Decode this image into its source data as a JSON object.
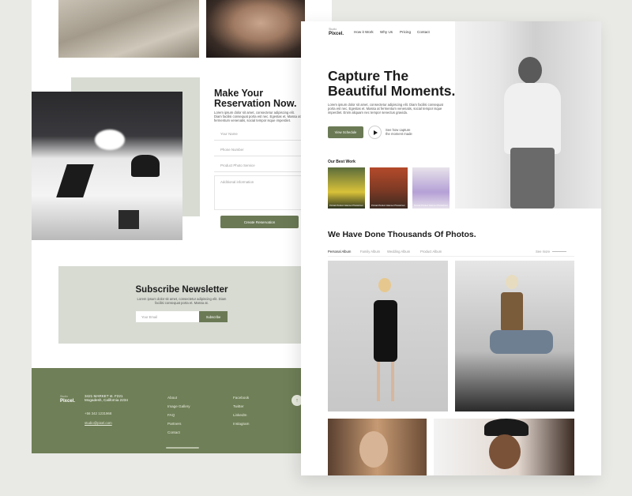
{
  "left": {
    "reservation": {
      "title_line1": "Make Your",
      "title_line2": "Reservation Now.",
      "desc": "Lorem ipsum dolor sit amet, consectetur adipiscing elit. Diam facilisi consequat porta est nec. Egestas et. Massa at fermentum venenatis, social tempor isque imperdiet.",
      "fields": [
        {
          "placeholder": "Your Name"
        },
        {
          "placeholder": "Phone Number"
        },
        {
          "placeholder": "Product Photo Service"
        }
      ],
      "textarea_placeholder": "Additional information",
      "button": "Create Reservation"
    },
    "newsletter": {
      "title": "Subscribe Newsletter",
      "desc": "Lorem ipsum dolor sit amet, consectetur adipiscing elit. Diam facilisi consequat porta et. Massa at.",
      "input_placeholder": "Your Email",
      "button": "Subscribe"
    },
    "footer": {
      "logo_small": "Studio",
      "logo": "Pixcel.",
      "address": "3421 MARKET st. F221 Mogadesh, California 2234",
      "phone": "+56 342 1231968",
      "email": "studio@pixel.com",
      "links_col1": [
        "About",
        "Image Gallery",
        "FAQ",
        "Partners",
        "Contact"
      ],
      "links_col2": [
        "Facebook",
        "Twitter",
        "LinkedIn",
        "Instagram"
      ],
      "scroll_icon": "arrow-up-icon"
    }
  },
  "right": {
    "nav": {
      "logo_small": "Studio",
      "logo": "Pixcel.",
      "items": [
        "How it Work",
        "Why Us",
        "Pricing",
        "Contact"
      ]
    },
    "hero": {
      "title_line1": "Capture The",
      "title_line2": "Beautiful Moments.",
      "desc": "Lorem ipsum dolor sit amet, consectetur adipiscing elit. Diam facilisi consequat porta est nec. Egestas et. Massa at fermentum venenatis, social tempor isque imperdiet. Enim aliquam nec tempor senectus gravida.",
      "primary_button": "View Schedule",
      "secondary_line1": "See how capture",
      "secondary_line2": "the moment made",
      "play_icon": "play-icon"
    },
    "best_work": {
      "heading": "Our Best Work",
      "items": [
        {
          "caption": "Portrait Product Glamour Photoshoot"
        },
        {
          "caption": "Portrait Product Glamour Photoshoot"
        },
        {
          "caption": "Portrait Product Glamour Photoshoot"
        }
      ]
    },
    "gallery": {
      "title": "We Have Done Thousands Of Photos.",
      "tabs": [
        "Personal Album",
        "Family Album",
        "Wedding Album",
        "Product Album"
      ],
      "see_more": "See more"
    }
  },
  "colors": {
    "accent": "#6b7a55",
    "footer_bg": "#6f7f57",
    "panel_bg": "#d7dbd2"
  }
}
